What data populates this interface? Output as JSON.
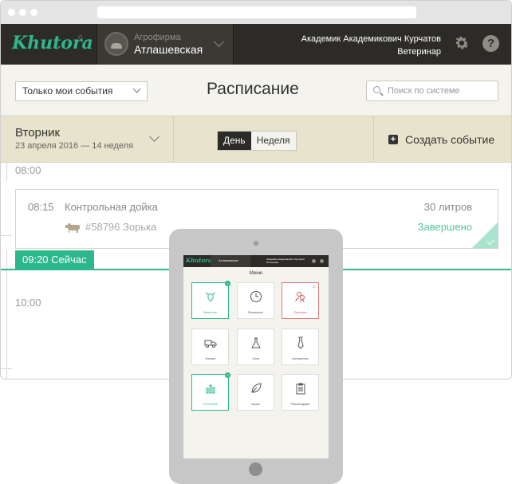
{
  "app": {
    "logo": "Khutora",
    "farm_label": "Агрофирма",
    "farm_name": "Атлашевская",
    "user_name": "Академик Академикович Курчатов",
    "user_role": "Ветеринар",
    "help_label": "?"
  },
  "toolbar": {
    "filter_value": "Только мои события",
    "title": "Расписание",
    "search_placeholder": "Поиск по системе"
  },
  "datebar": {
    "day_name": "Вторник",
    "date_line": "23 апреля 2016 — 14 неделя",
    "view_tabs": [
      {
        "label": "День",
        "active": true
      },
      {
        "label": "Неделя",
        "active": false
      }
    ],
    "create_label": "Создать событие"
  },
  "timeline": {
    "hours": [
      "08:00",
      "10:00"
    ],
    "event": {
      "time": "08:15",
      "title": "Контрольная дойка",
      "amount": "30 литров",
      "animal": "#58796 Зорька",
      "status": "Завершено"
    },
    "now_label": "09:20 Сейчас"
  },
  "tablet": {
    "menu_title": "Меню",
    "mini_farm": "Атлашевская",
    "mini_user": "Академик Академикович Курчатов",
    "mini_role": "Ветеринар",
    "tiles": [
      {
        "label": "Животные",
        "icon": "cow-head-icon",
        "state": "green",
        "badge": "1"
      },
      {
        "label": "Расписание",
        "icon": "clock-icon",
        "state": "normal"
      },
      {
        "label": "Персонал",
        "icon": "people-icon",
        "state": "red"
      },
      {
        "label": "Техника",
        "icon": "truck-icon",
        "state": "normal"
      },
      {
        "label": "Сила",
        "icon": "flask-icon",
        "state": "normal"
      },
      {
        "label": "Контрагенты",
        "icon": "tie-icon",
        "state": "normal"
      },
      {
        "label": "Статистика",
        "icon": "bar-chart-icon",
        "state": "green",
        "badge": "3"
      },
      {
        "label": "Корма",
        "icon": "leaf-icon",
        "state": "normal"
      },
      {
        "label": "Рекомендации",
        "icon": "clipboard-icon",
        "state": "normal"
      }
    ]
  },
  "colors": {
    "accent": "#2db78c",
    "topbar": "#2c2b27",
    "datebar": "#e7e3cc",
    "toolbar": "#f4f3ee",
    "alert": "#e07a7a"
  }
}
